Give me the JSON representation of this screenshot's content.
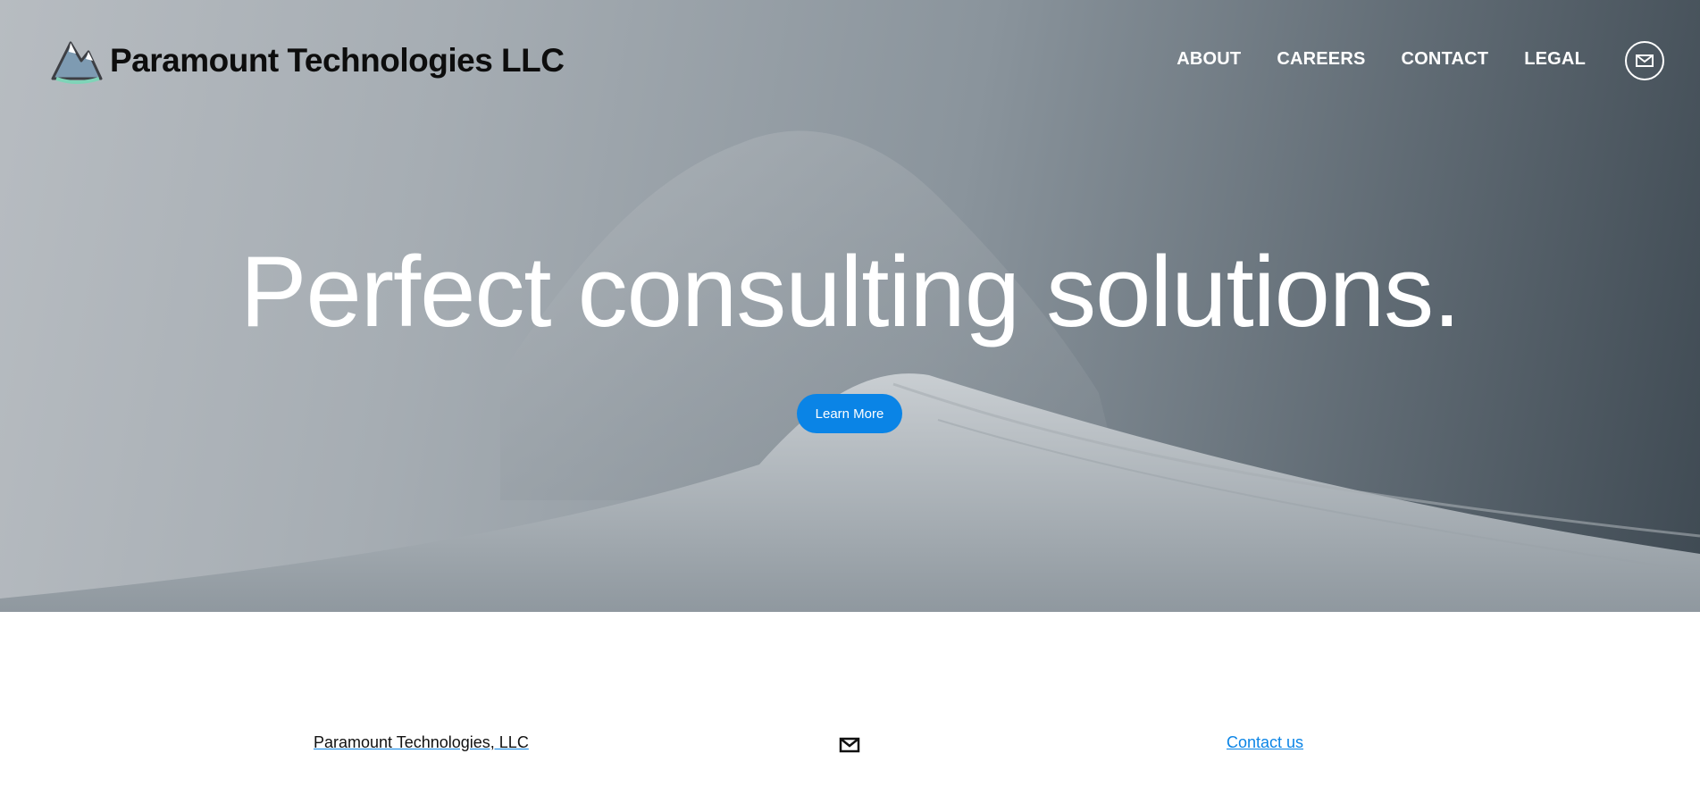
{
  "header": {
    "brand": "Paramount Technologies LLC",
    "logo_icon": "mountain-logo-icon",
    "nav": [
      "ABOUT",
      "CAREERS",
      "CONTACT",
      "LEGAL"
    ],
    "mail_icon": "envelope-icon"
  },
  "hero": {
    "headline": "Perfect consulting solutions.",
    "cta_label": "Learn More"
  },
  "footer": {
    "company": "Paramount Technologies, LLC",
    "mail_icon": "envelope-icon",
    "contact_link": "Contact us"
  },
  "colors": {
    "accent": "#0a84e6",
    "headline_text": "#ffffff",
    "brand_text": "#0d0d0d"
  }
}
